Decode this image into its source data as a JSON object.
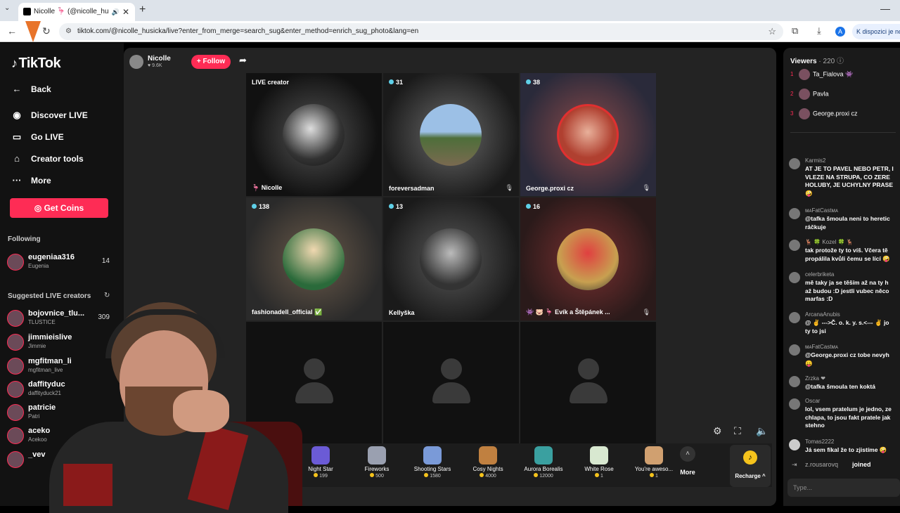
{
  "browser": {
    "tab_title": "Nicolle 🦩 (@nicolle_hu",
    "url": "tiktok.com/@nicolle_husicka/live?enter_from_merge=search_sug&enter_method=enrich_sug_photo&lang=en",
    "profile_initial": "A",
    "side_button": "K dispozici je no"
  },
  "sidebar": {
    "logo": "TikTok",
    "back": "Back",
    "discover": "Discover LIVE",
    "golive": "Go LIVE",
    "creator_tools": "Creator tools",
    "more": "More",
    "get_coins": "Get Coins",
    "following_header": "Following",
    "following": [
      {
        "name": "eugeniaa316",
        "sub": "Eugenia",
        "count": "14"
      }
    ],
    "suggested_header": "Suggested LIVE creators",
    "suggested": [
      {
        "name": "bojovnice_tlu...",
        "sub": "TLUSTICE",
        "count": "309"
      },
      {
        "name": "jimmieislive",
        "sub": "Jimmie",
        "count": ""
      },
      {
        "name": "mgfitman_li",
        "sub": "mgfitman_live",
        "count": ""
      },
      {
        "name": "daffityduc",
        "sub": "daffityduck21",
        "count": ""
      },
      {
        "name": "patricie",
        "sub": "Patri",
        "count": ""
      },
      {
        "name": "aceko",
        "sub": "Acekoo",
        "count": ""
      },
      {
        "name": "_vev",
        "sub": "",
        "count": ""
      }
    ]
  },
  "host": {
    "name": "Nicolle",
    "likes": "9.6K",
    "follow_label": "+ Follow"
  },
  "tiles": [
    {
      "label": "LIVE creator",
      "name": "Nicolle",
      "count": ""
    },
    {
      "label": "",
      "name": "foreversadman",
      "count": "31"
    },
    {
      "label": "",
      "name": "George.proxi cz",
      "count": "38"
    },
    {
      "label": "",
      "name": "fashionadell_official",
      "count": "138"
    },
    {
      "label": "",
      "name": "Kellyška",
      "count": "13"
    },
    {
      "label": "",
      "name": "Evík a Štěpánek ...",
      "count": "16"
    }
  ],
  "gifts": [
    {
      "name": "Night Star",
      "price": "199",
      "color": "#6b5bd6"
    },
    {
      "name": "Fireworks",
      "price": "500",
      "color": "#9aa0b0"
    },
    {
      "name": "Shooting Stars",
      "price": "1580",
      "color": "#7a9ad8"
    },
    {
      "name": "Cosy Nights",
      "price": "4000",
      "color": "#c08040"
    },
    {
      "name": "Aurora Borealis",
      "price": "12000",
      "color": "#3aa0a0"
    },
    {
      "name": "White Rose",
      "price": "1",
      "color": "#d8e8d0"
    },
    {
      "name": "You're aweso...",
      "price": "1",
      "color": "#d0a070"
    }
  ],
  "more_label": "More",
  "recharge_label": "Recharge ^",
  "viewers": {
    "title": "Viewers",
    "count": "· 220",
    "top": [
      {
        "rank": "1",
        "name": "Ta_Fialova 👾"
      },
      {
        "rank": "2",
        "name": "Pavla"
      },
      {
        "rank": "3",
        "name": "George.proxi cz"
      }
    ]
  },
  "chat": [
    {
      "user": "Karmis2",
      "text": "AT JE TO PAVEL NEBO PETR, I\nVLEZE NA STRUPA, CO ZERE\nHOLUBY, JE UCHYLNY PRASE\n🤪"
    },
    {
      "user": "ᴍᴀFatCastᴍᴀ",
      "text": "@tafka šmoula neni to heretic\nráčkuje"
    },
    {
      "user": "🦌 🍀 Kozel 🍀 🦌",
      "text": "tak protože ty to víš. Včera tě\npropálila kvůli čemu se lící 🤪"
    },
    {
      "user": "celerbriketa",
      "text": "mě taky ja se těším až na ty h\naž budou :D jestli vubec něco\nmarfas :D"
    },
    {
      "user": "ArcanaAnubis",
      "text": "@ ✌ --->Č. o. k. y. s.<--- ✌ jo\nty to jsi"
    },
    {
      "user": "ᴍᴀFatCastᴍᴀ",
      "text": "@George.proxi cz tobe nevyh\n😛"
    },
    {
      "user": "Zrzka ❤",
      "text": "@tafka šmoula ten koktá"
    },
    {
      "user": "Oscar",
      "text": "lol, vsem pratelum je jedno, ze\nchlapa, to jsou fakt pratele jak\nstehno"
    },
    {
      "user": "Tomas2222",
      "text": "Já sem fíkal že to zjistíme 🤪"
    }
  ],
  "joined": {
    "user": "z.rousarovq",
    "text": "joined"
  },
  "type_placeholder": "Type..."
}
